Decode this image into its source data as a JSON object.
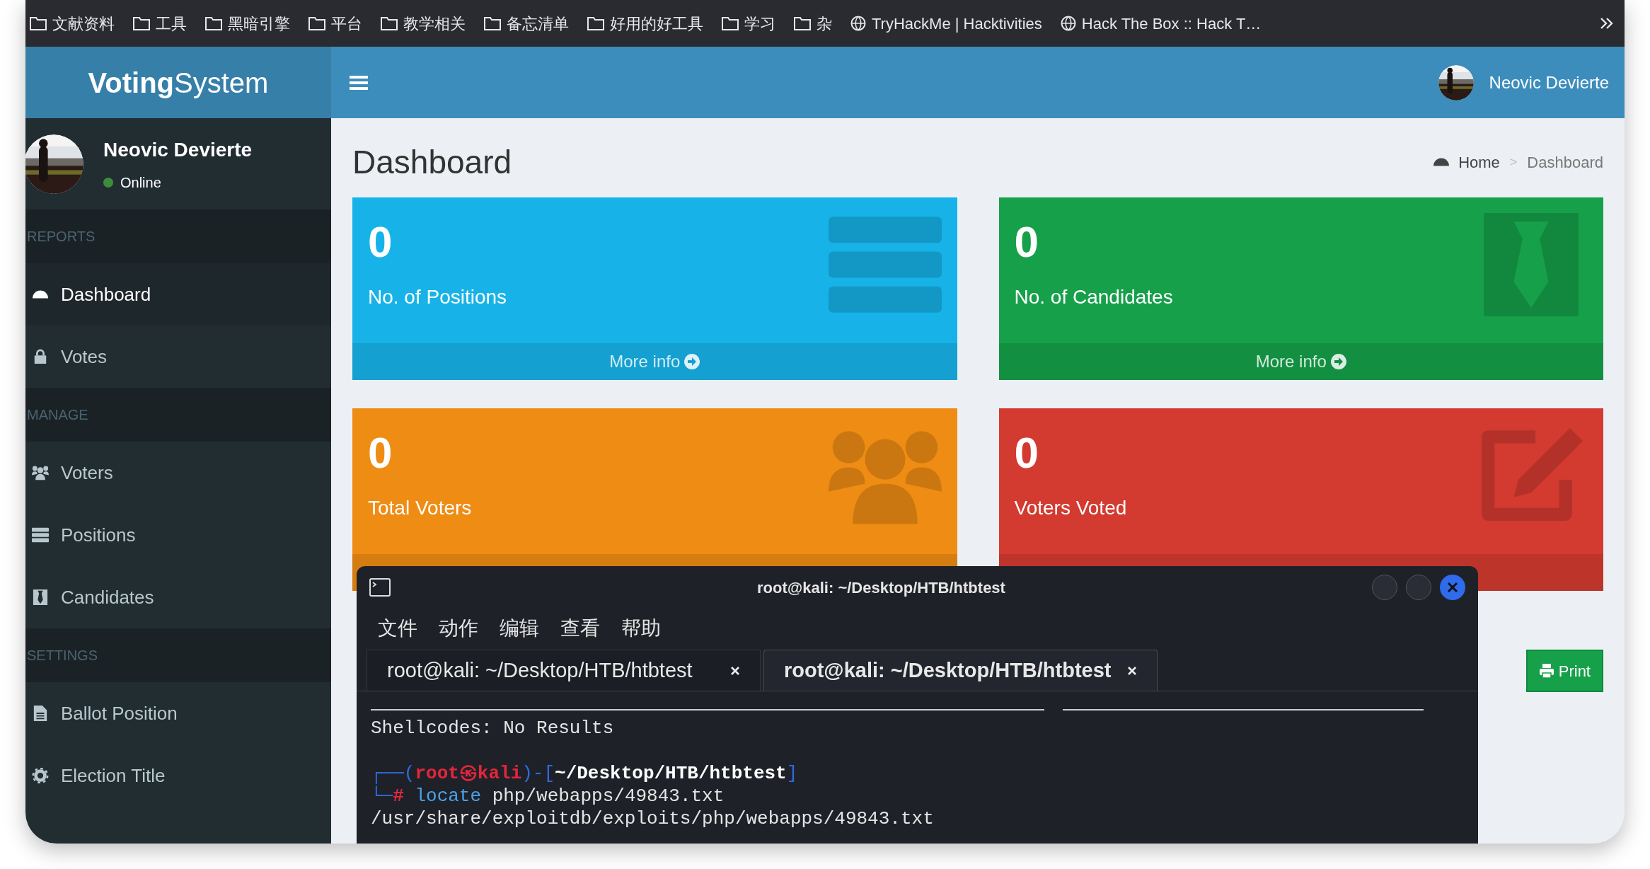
{
  "bookmarks": [
    {
      "label": "文献资料",
      "kind": "folder"
    },
    {
      "label": "工具",
      "kind": "folder"
    },
    {
      "label": "黑暗引擎",
      "kind": "folder"
    },
    {
      "label": "平台",
      "kind": "folder"
    },
    {
      "label": "教学相关",
      "kind": "folder"
    },
    {
      "label": "备忘清单",
      "kind": "folder"
    },
    {
      "label": "好用的好工具",
      "kind": "folder"
    },
    {
      "label": "学习",
      "kind": "folder"
    },
    {
      "label": "杂",
      "kind": "folder"
    },
    {
      "label": "TryHackMe | Hacktivities",
      "kind": "site"
    },
    {
      "label": "Hack The Box :: Hack T…",
      "kind": "site"
    }
  ],
  "brand": {
    "bold": "Voting",
    "regular": "System"
  },
  "navbar": {
    "user_name": "Neovic Devierte"
  },
  "user_panel": {
    "name": "Neovic Devierte",
    "status": "Online"
  },
  "sidebar": [
    {
      "header": "REPORTS",
      "items": [
        {
          "label": "Dashboard",
          "selected": true
        },
        {
          "label": "Votes",
          "selected": false
        }
      ]
    },
    {
      "header": "MANAGE",
      "items": [
        {
          "label": "Voters",
          "selected": false
        },
        {
          "label": "Positions",
          "selected": false
        },
        {
          "label": "Candidates",
          "selected": false
        }
      ]
    },
    {
      "header": "SETTINGS",
      "items": [
        {
          "label": "Ballot Position",
          "selected": false
        },
        {
          "label": "Election Title",
          "selected": false
        }
      ]
    }
  ],
  "page": {
    "title": "Dashboard",
    "breadcrumb": [
      {
        "label": "Home"
      },
      {
        "label": "Dashboard"
      }
    ],
    "separator": ">"
  },
  "cards": [
    {
      "value": "0",
      "label": "No. of Positions",
      "color": "#17b3e8",
      "footer": "More info"
    },
    {
      "value": "0",
      "label": "No. of Candidates",
      "color": "#16a04a",
      "footer": "More info"
    },
    {
      "value": "0",
      "label": "Total Voters",
      "color": "#ef8c14"
    },
    {
      "value": "0",
      "label": "Voters Voted",
      "color": "#d33a30"
    }
  ],
  "print_button": "Print",
  "terminal": {
    "title": "root@kali: ~/Desktop/HTB/htbtest",
    "menu": [
      "文件",
      "动作",
      "编辑",
      "查看",
      "帮助"
    ],
    "tabs": [
      {
        "label": "root@kali: ~/Desktop/HTB/htbtest",
        "selected": false
      },
      {
        "label": "root@kali: ~/Desktop/HTB/htbtest",
        "selected": true
      }
    ],
    "lines": [
      {
        "kind": "rule"
      },
      {
        "kind": "text",
        "segments": [
          {
            "text": "Shellcodes: No Results",
            "kind": "plain"
          }
        ]
      },
      {
        "kind": "blank"
      },
      {
        "kind": "text",
        "segments": [
          {
            "text": "┌──(",
            "kind": "frame"
          },
          {
            "text": "root㉿kali",
            "kind": "user"
          },
          {
            "text": ")-[",
            "kind": "frame"
          },
          {
            "text": "~/Desktop/HTB/htbtest",
            "kind": "path"
          },
          {
            "text": "]",
            "kind": "frame"
          }
        ]
      },
      {
        "kind": "text",
        "segments": [
          {
            "text": "└─",
            "kind": "frame"
          },
          {
            "text": "# ",
            "kind": "hash"
          },
          {
            "text": "locate ",
            "kind": "command"
          },
          {
            "text": "php/webapps/49843.txt",
            "kind": "plain"
          }
        ]
      },
      {
        "kind": "text",
        "segments": [
          {
            "text": "/usr/share/exploitdb/exploits/php/webapps/49843.txt",
            "kind": "plain"
          }
        ]
      }
    ]
  }
}
